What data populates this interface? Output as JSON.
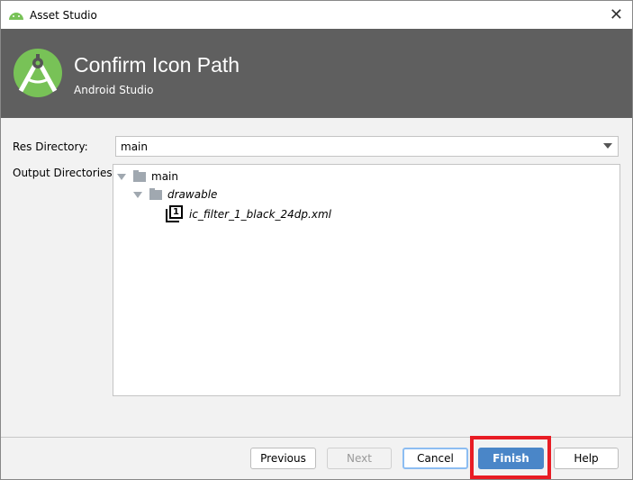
{
  "window": {
    "title": "Asset Studio",
    "close_icon": "close-icon"
  },
  "header": {
    "title": "Confirm Icon Path",
    "subtitle": "Android Studio"
  },
  "form": {
    "res_directory_label": "Res Directory:",
    "res_directory_value": "main",
    "output_directories_label": "Output Directories:"
  },
  "tree": {
    "root": "main",
    "child": "drawable",
    "file": "ic_filter_1_black_24dp.xml",
    "file_icon_text": "1"
  },
  "buttons": {
    "previous": "Previous",
    "next": "Next",
    "cancel": "Cancel",
    "finish": "Finish",
    "help": "Help"
  },
  "colors": {
    "header": "#5f5f5f",
    "primary": "#4a86c8",
    "highlight": "#e81c24",
    "android_green": "#78c257"
  }
}
